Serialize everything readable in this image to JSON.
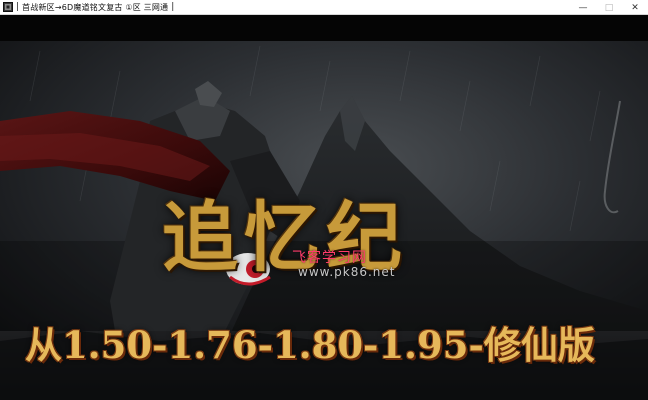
{
  "window": {
    "title": "首战新区→6D魔道铭文复古 ①区 三网通",
    "separator": "|",
    "controls": {
      "minimize": "—",
      "maximize": "□",
      "close": "✕"
    }
  },
  "game": {
    "logo_text": "追忆纪",
    "watermark": "飞客学习网",
    "watermark_url": "www.pk86.net",
    "versions": "从1.50-1.76-1.80-1.95-修仙版"
  },
  "colors": {
    "logo_gold": "#c79a3a",
    "versions_gold": "#e6b85a",
    "watermark_pink": "#ff3b6b",
    "background_dark": "#1a1b1d"
  }
}
